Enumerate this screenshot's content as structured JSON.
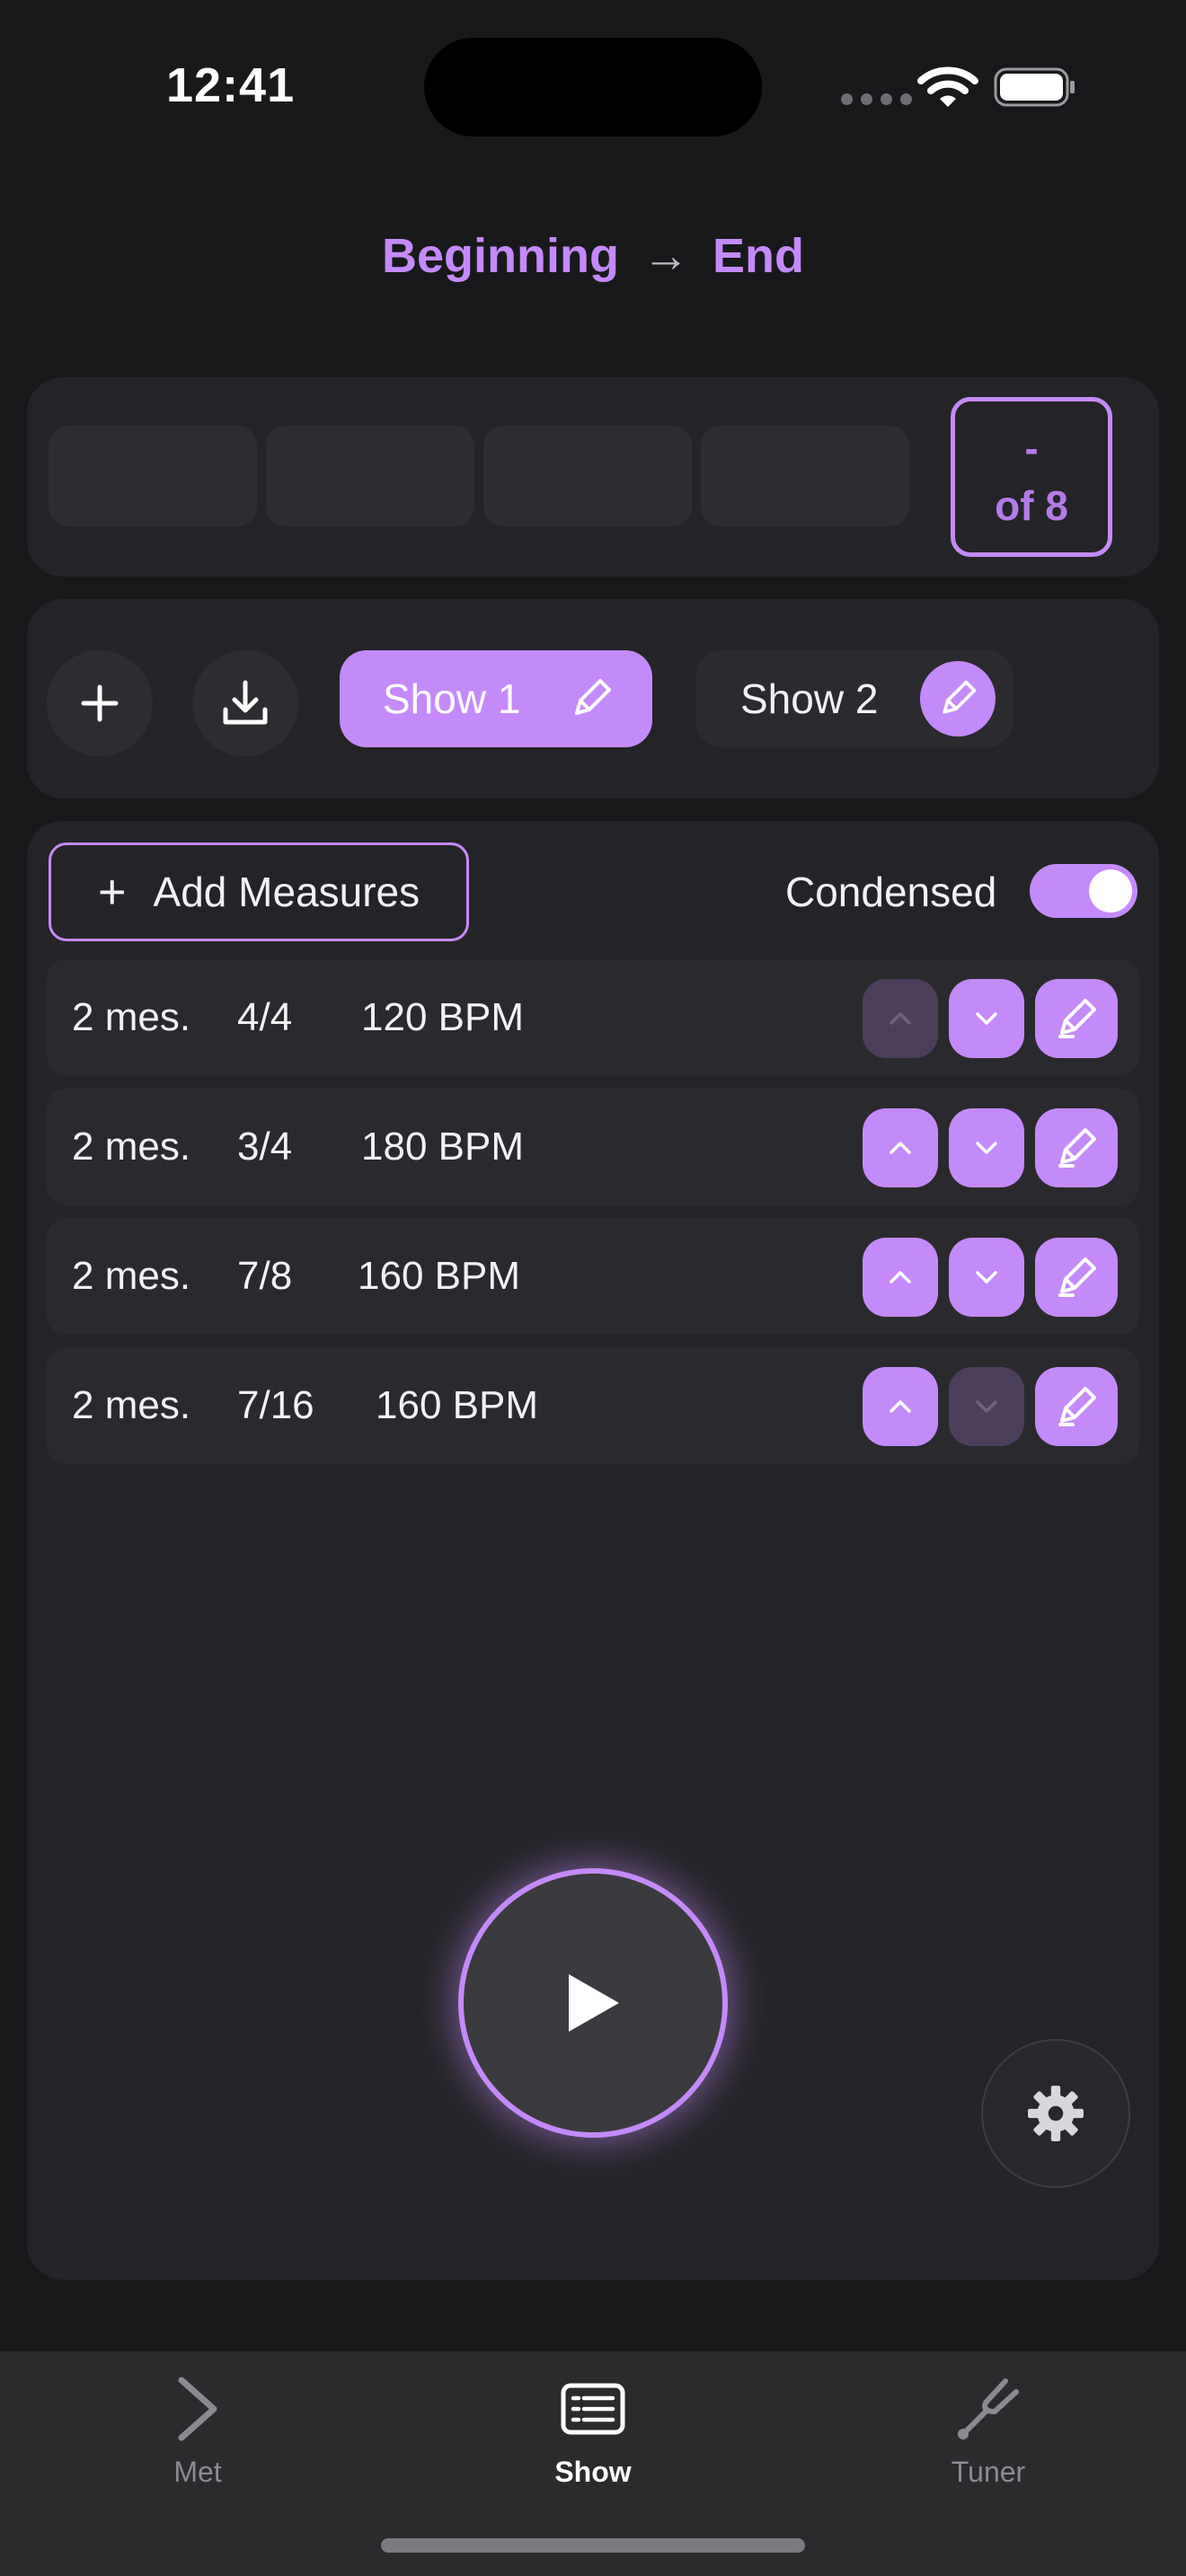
{
  "status_bar": {
    "time": "12:41"
  },
  "range": {
    "start": "Beginning",
    "arrow": "→",
    "end": "End"
  },
  "measure_counter": {
    "current": "-",
    "total": "of 8"
  },
  "shows": {
    "add_icon": "plus-icon",
    "import_icon": "download-icon",
    "items": [
      {
        "label": "Show 1",
        "active": true
      },
      {
        "label": "Show 2",
        "active": false
      }
    ]
  },
  "measures": {
    "add_label": "Add Measures",
    "add_icon": "+",
    "condensed_label": "Condensed",
    "condensed_on": true,
    "rows": [
      {
        "count": "2 mes.",
        "time_sig": "4/4",
        "tempo": "120 BPM",
        "up_enabled": false,
        "down_enabled": true
      },
      {
        "count": "2 mes.",
        "time_sig": "3/4",
        "tempo": "180 BPM",
        "up_enabled": true,
        "down_enabled": true
      },
      {
        "count": "2 mes.",
        "time_sig": "7/8",
        "tempo": "160 BPM",
        "up_enabled": true,
        "down_enabled": true
      },
      {
        "count": "2 mes.",
        "time_sig": "7/16",
        "tempo": "160 BPM",
        "up_enabled": true,
        "down_enabled": false
      }
    ]
  },
  "tabs": [
    {
      "label": "Met",
      "icon": "chevron-right-icon",
      "selected": false
    },
    {
      "label": "Show",
      "icon": "list-icon",
      "selected": true
    },
    {
      "label": "Tuner",
      "icon": "tuning-fork-icon",
      "selected": false
    }
  ],
  "colors": {
    "accent": "#c58af9",
    "background": "#19191c",
    "panel": "#242428"
  }
}
